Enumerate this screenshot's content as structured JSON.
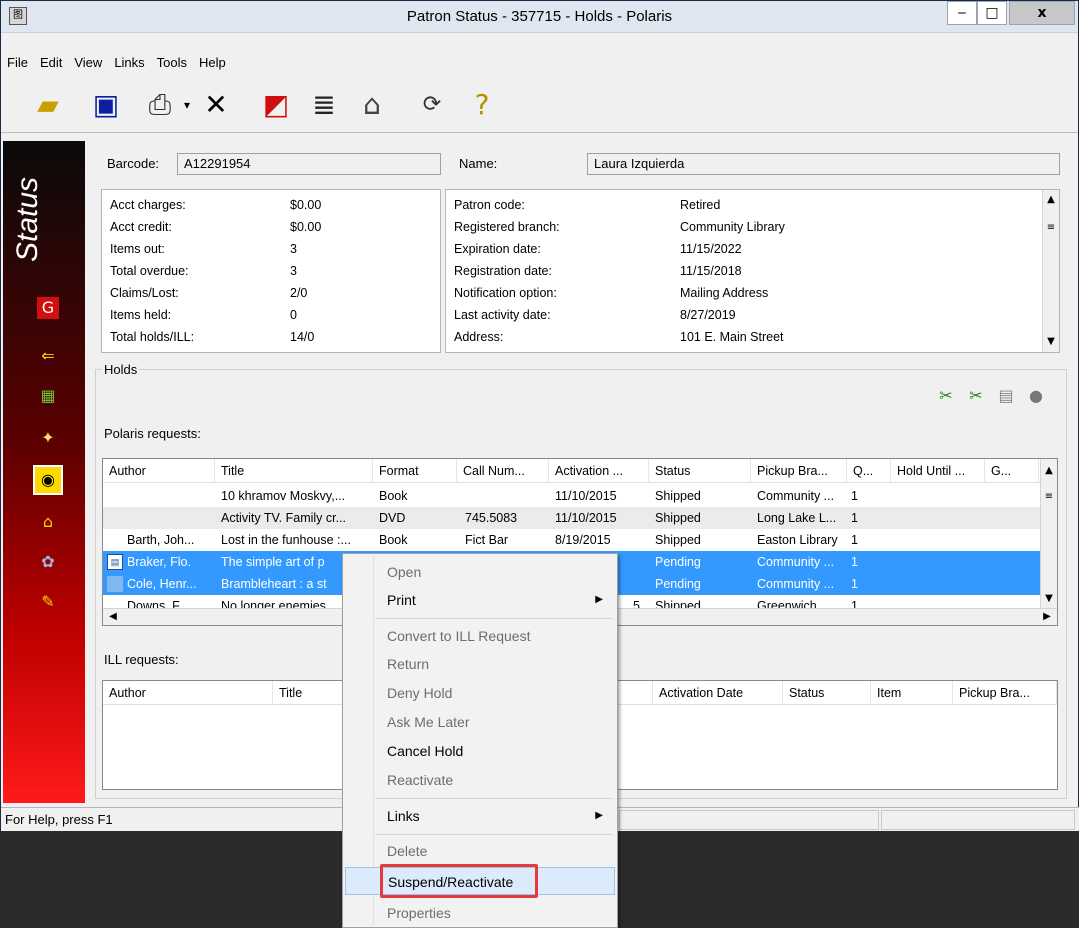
{
  "window": {
    "title": "Patron Status - 357715 - Holds - Polaris",
    "min_glyph": "‒",
    "max_glyph": "□",
    "close_glyph": "x"
  },
  "menu": [
    "File",
    "Edit",
    "View",
    "Links",
    "Tools",
    "Help"
  ],
  "toolbar_icons": [
    "open-folder-icon",
    "save-icon",
    "print-icon",
    "dropdown-arrow-icon",
    "delete-icon",
    "check-in-icon",
    "check-out-icon",
    "properties-icon",
    "refresh-icon",
    "help-icon"
  ],
  "sidebar": {
    "label": "Status",
    "icons": [
      "charges-icon",
      "items-out-icon",
      "register-icon",
      "claims-icon",
      "holds-icon",
      "home-icon",
      "patron-notes-icon",
      "edit-icon"
    ]
  },
  "patron": {
    "barcode_label": "Barcode:",
    "barcode": "A12291954",
    "name_label": "Name:",
    "name": "Laura Izquierda"
  },
  "stats_left": [
    {
      "label": "Acct charges:",
      "value": "$0.00"
    },
    {
      "label": "Acct credit:",
      "value": "$0.00"
    },
    {
      "label": "Items out:",
      "value": "3"
    },
    {
      "label": "Total overdue:",
      "value": "3"
    },
    {
      "label": "Claims/Lost:",
      "value": "2/0"
    },
    {
      "label": "Items held:",
      "value": "0"
    },
    {
      "label": "Total holds/ILL:",
      "value": "14/0"
    }
  ],
  "stats_right": [
    {
      "label": "Patron code:",
      "value": "Retired"
    },
    {
      "label": "Registered branch:",
      "value": "Community Library"
    },
    {
      "label": "Expiration date:",
      "value": "11/15/2022"
    },
    {
      "label": "Registration date:",
      "value": "11/15/2018"
    },
    {
      "label": "Notification option:",
      "value": "Mailing Address"
    },
    {
      "label": "Last activity date:",
      "value": "8/27/2019"
    },
    {
      "label": "Address:",
      "value": "101 E. Main Street"
    }
  ],
  "holds": {
    "group_label": "Holds",
    "polaris_label": "Polaris requests:",
    "ill_label": "ILL requests:",
    "columns": [
      "Author",
      "Title",
      "Format",
      "Call Num...",
      "Activation ...",
      "Status",
      "Pickup Bra...",
      "Q...",
      "Hold Until ...",
      "G..."
    ],
    "rows": [
      {
        "author": "",
        "title": "10 khramov Moskvy,...",
        "format": "Book",
        "callnum": "",
        "activation": "11/10/2015",
        "status": "Shipped",
        "pickup": "Community ...",
        "q": "1"
      },
      {
        "author": "",
        "title": "Activity TV. Family cr...",
        "format": "DVD",
        "callnum": "745.5083",
        "activation": "11/10/2015",
        "status": "Shipped",
        "pickup": "Long Lake L...",
        "q": "1"
      },
      {
        "author": "Barth, Joh...",
        "title": "Lost in the funhouse :...",
        "format": "Book",
        "callnum": "Fict Bar",
        "activation": "8/19/2015",
        "status": "Shipped",
        "pickup": "Easton Library",
        "q": "1"
      },
      {
        "author": "Braker, Flo.",
        "title": "The simple art of p",
        "format": "",
        "callnum": "",
        "activation": "",
        "status": "Pending",
        "pickup": "Community ...",
        "q": "1"
      },
      {
        "author": "Cole, Henr...",
        "title": "Brambleheart : a st",
        "format": "",
        "callnum": "",
        "activation": "",
        "status": "Pending",
        "pickup": "Community ...",
        "q": "1"
      },
      {
        "author": "Downs, F...",
        "title": "No longer enemies",
        "format": "",
        "callnum": "",
        "activation": "5",
        "status": "Shipped",
        "pickup": "Greenwich ...",
        "q": "1"
      }
    ],
    "ill_columns": [
      "Author",
      "Title",
      "Activation Date",
      "Status",
      "Item",
      "Pickup Bra..."
    ]
  },
  "statusbar": {
    "text": "For Help, press F1"
  },
  "context_menu": {
    "items": [
      {
        "label": "Open",
        "enabled": false
      },
      {
        "label": "Print",
        "enabled": true,
        "submenu": true
      },
      {
        "label": "Convert to ILL Request",
        "enabled": false
      },
      {
        "label": "Return",
        "enabled": false
      },
      {
        "label": "Deny Hold",
        "enabled": false
      },
      {
        "label": "Ask Me Later",
        "enabled": false
      },
      {
        "label": "Cancel Hold",
        "enabled": true
      },
      {
        "label": "Reactivate",
        "enabled": false
      },
      {
        "label": "Links",
        "enabled": true,
        "submenu": true
      },
      {
        "label": "Delete",
        "enabled": false
      },
      {
        "label": "Suspend/Reactivate",
        "enabled": true,
        "highlighted": true
      },
      {
        "label": "Properties",
        "enabled": false
      }
    ],
    "submenu_glyph": "▶"
  },
  "colors": {
    "selection": "#3399ff",
    "highlight_box": "#e53a3a",
    "sidebar_gradient_top": "#0a0a0a",
    "sidebar_gradient_bottom": "#ff1a1a"
  }
}
